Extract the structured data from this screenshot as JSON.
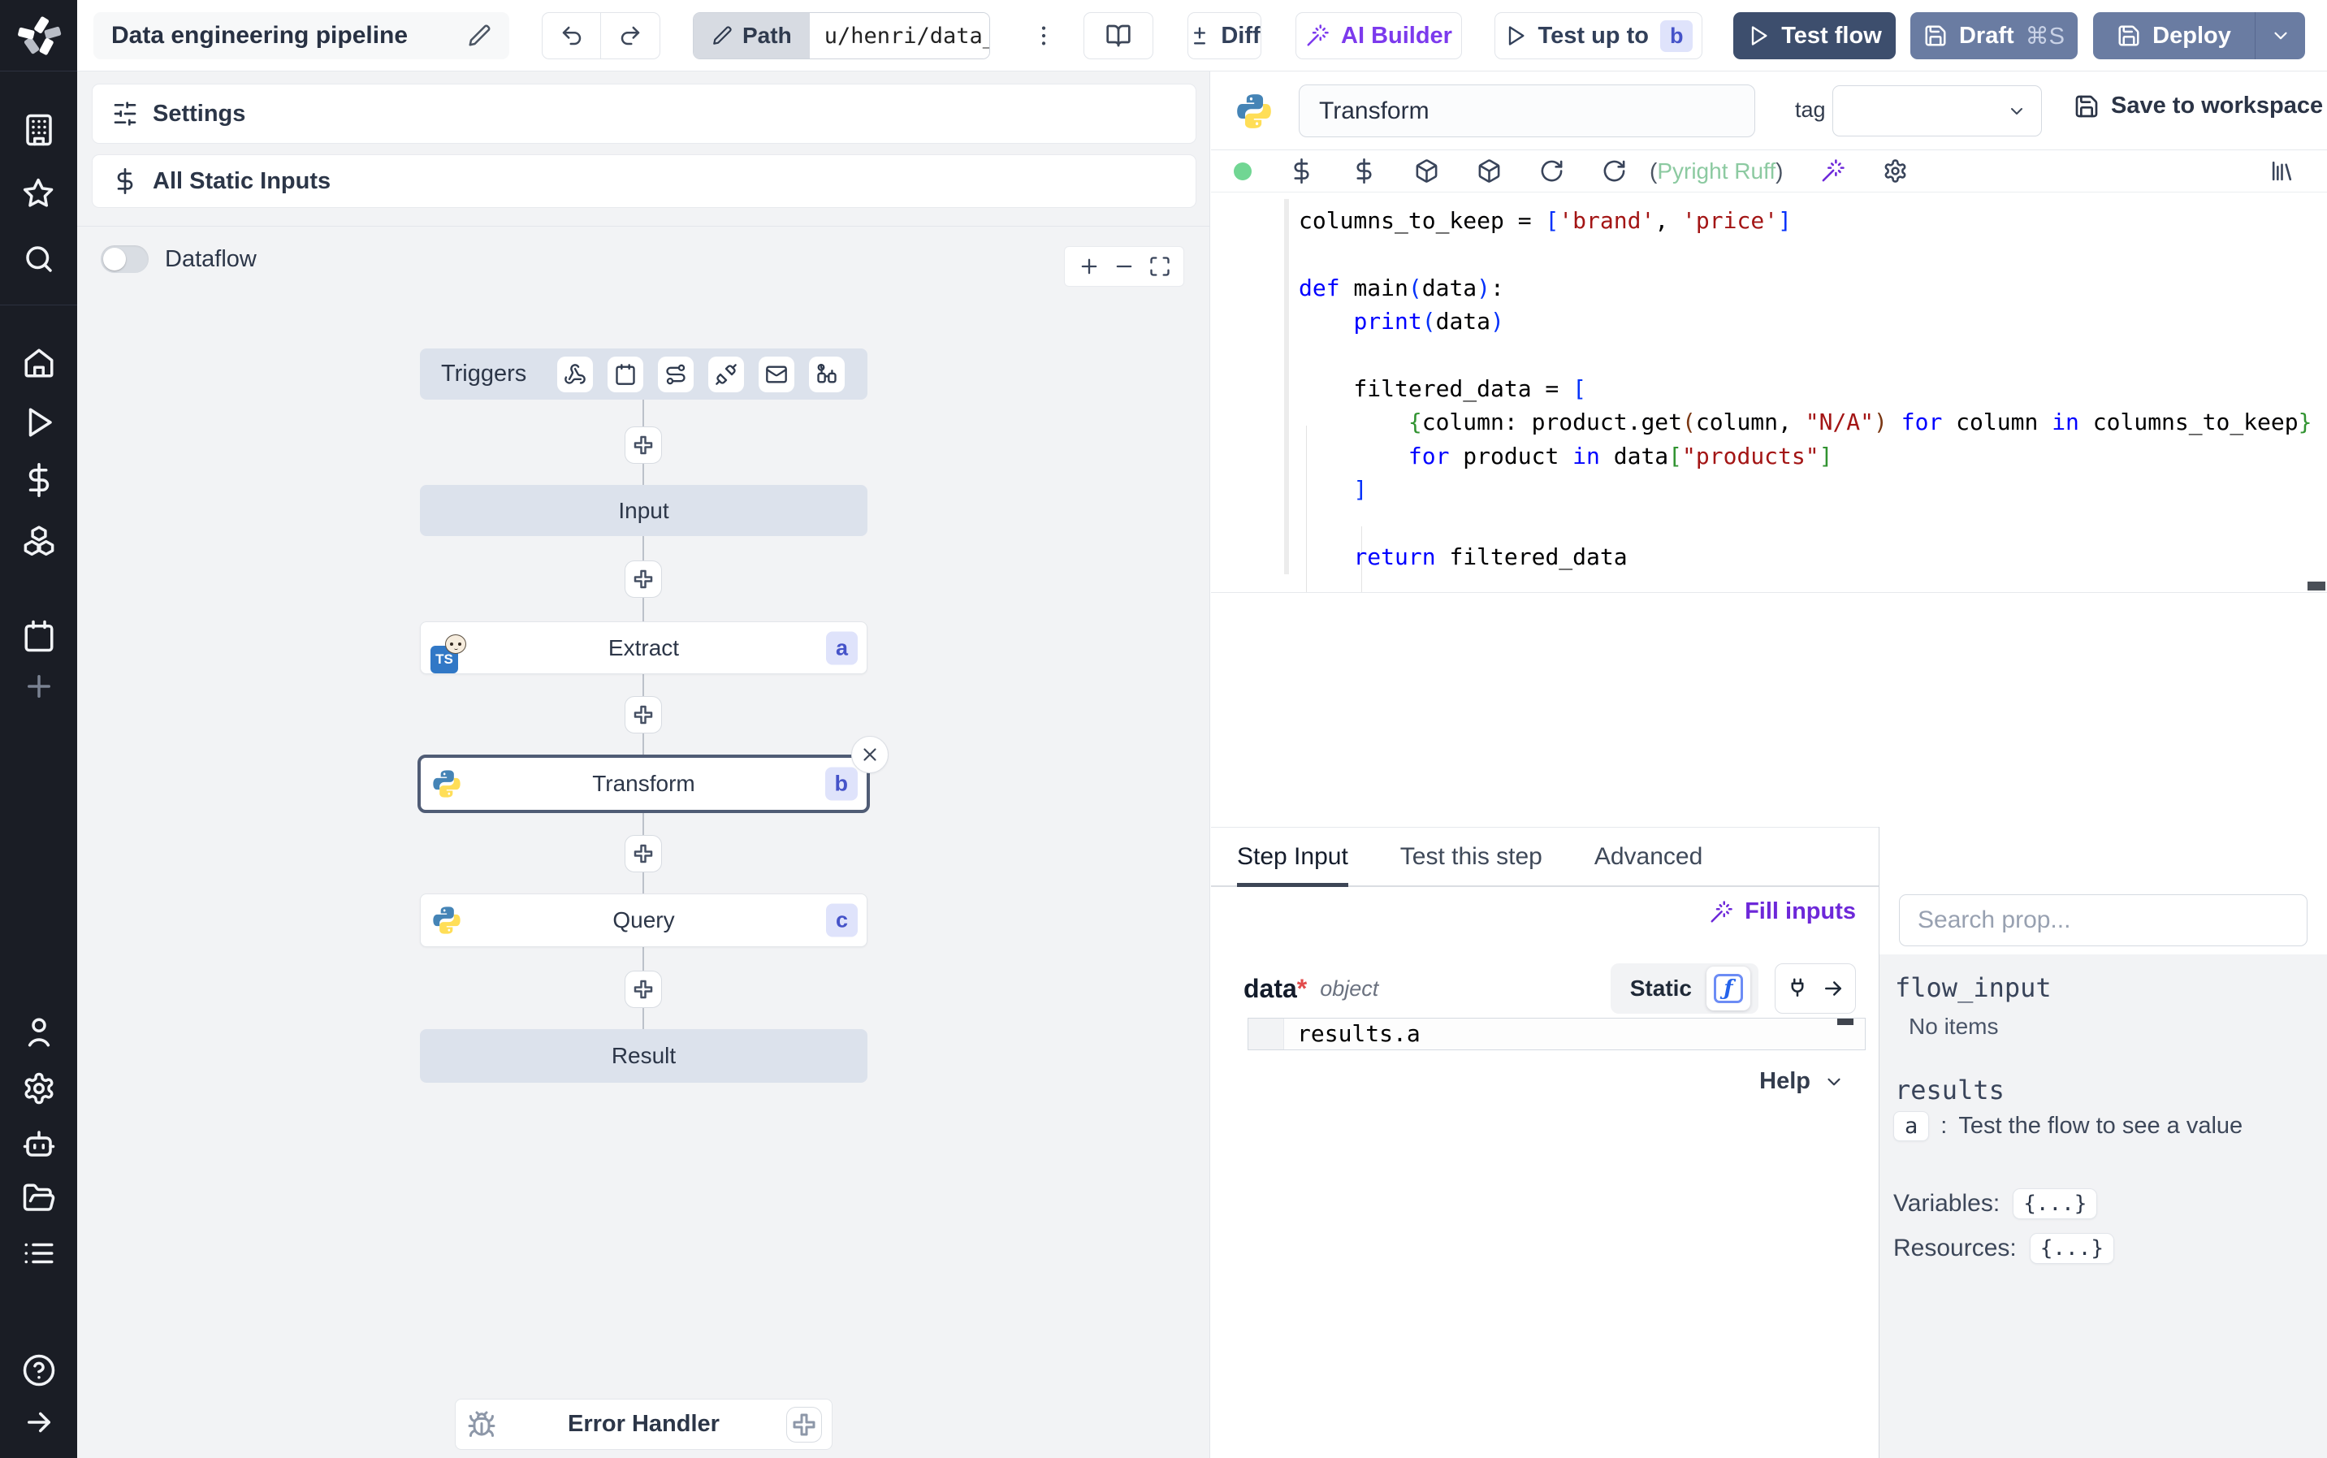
{
  "header": {
    "title": "Data engineering pipeline",
    "path_label": "Path",
    "path_value": "u/henri/data_",
    "diff_label": "Diff",
    "ai_builder_label": "AI Builder",
    "test_up_to_label": "Test up to",
    "test_up_to_badge": "b",
    "test_flow_label": "Test flow",
    "draft_label": "Draft",
    "draft_shortcut": "⌘S",
    "deploy_label": "Deploy"
  },
  "flow": {
    "settings_label": "Settings",
    "all_static_inputs_label": "All Static Inputs",
    "dataflow_label": "Dataflow",
    "triggers_label": "Triggers",
    "trigger_icons": [
      "webhook",
      "schedule-calendar",
      "route",
      "plug",
      "email",
      "poll-watch"
    ],
    "nodes": {
      "input": {
        "label": "Input"
      },
      "extract": {
        "label": "Extract",
        "badge": "a",
        "language": "bun-typescript"
      },
      "transform": {
        "label": "Transform",
        "badge": "b",
        "language": "python",
        "selected": true
      },
      "query": {
        "label": "Query",
        "badge": "c",
        "language": "python"
      },
      "result": {
        "label": "Result"
      },
      "error_handler": {
        "label": "Error Handler"
      }
    }
  },
  "step": {
    "name": "Transform",
    "tag_label": "tag",
    "save_label": "Save to workspace",
    "assistant_open": "(",
    "assistant_name": "Pyright Ruff",
    "assistant_close": ")",
    "code": {
      "language": "python",
      "lines": [
        [
          [
            "d",
            "columns_to_keep = "
          ],
          [
            "b1",
            "["
          ],
          [
            "s",
            "'brand'"
          ],
          [
            "d",
            ", "
          ],
          [
            "s",
            "'price'"
          ],
          [
            "b1",
            "]"
          ]
        ],
        [],
        [
          [
            "k",
            "def"
          ],
          [
            "d",
            " main"
          ],
          [
            "b1",
            "("
          ],
          [
            "d",
            "data"
          ],
          [
            "b1",
            ")"
          ],
          [
            "d",
            ":"
          ]
        ],
        [
          [
            "d",
            "    "
          ],
          [
            "k",
            "print"
          ],
          [
            "b1",
            "("
          ],
          [
            "d",
            "data"
          ],
          [
            "b1",
            ")"
          ]
        ],
        [],
        [
          [
            "d",
            "    filtered_data = "
          ],
          [
            "b1",
            "["
          ]
        ],
        [
          [
            "d",
            "        "
          ],
          [
            "b2",
            "{"
          ],
          [
            "d",
            "column: product.get"
          ],
          [
            "b3",
            "("
          ],
          [
            "d",
            "column, "
          ],
          [
            "s",
            "\"N/A\""
          ],
          [
            "b3",
            ")"
          ],
          [
            "d",
            " "
          ],
          [
            "k",
            "for"
          ],
          [
            "d",
            " column "
          ],
          [
            "k",
            "in"
          ],
          [
            "d",
            " columns_to_keep"
          ],
          [
            "b2",
            "}"
          ]
        ],
        [
          [
            "d",
            "        "
          ],
          [
            "k",
            "for"
          ],
          [
            "d",
            " product "
          ],
          [
            "k",
            "in"
          ],
          [
            "d",
            " data"
          ],
          [
            "b2",
            "["
          ],
          [
            "s",
            "\"products\""
          ],
          [
            "b2",
            "]"
          ]
        ],
        [
          [
            "d",
            "    "
          ],
          [
            "b1",
            "]"
          ]
        ],
        [],
        [
          [
            "d",
            "    "
          ],
          [
            "k",
            "return"
          ],
          [
            "d",
            " filtered_data"
          ]
        ]
      ]
    },
    "tabs": [
      "Step Input",
      "Test this step",
      "Advanced"
    ],
    "fill_inputs_label": "Fill inputs",
    "arg_name": "data",
    "arg_required": "*",
    "arg_type": "object",
    "static_label": "Static",
    "fx_glyph": "ƒ",
    "expr_value": "results.a",
    "help_label": "Help"
  },
  "props": {
    "search_placeholder": "Search prop...",
    "flow_input_label": "flow_input",
    "flow_input_empty": "No items",
    "results_label": "results",
    "result_key": "a",
    "result_sep": ":",
    "result_hint": "Test the flow to see a value",
    "variables_label": "Variables:",
    "variables_value": "{...}",
    "resources_label": "Resources:",
    "resources_value": "{...}"
  },
  "colors": {
    "sidebar_bg": "#1a1d25",
    "canvas_bg": "#f2f3f5",
    "test_flow_bg": "#3d4e6d",
    "draft_deploy_bg": "#6a7ca2",
    "badge_bg": "#dfe3fb",
    "badge_text": "#4553c9",
    "selected_node_border": "#505c75",
    "muted_node_bg": "#dce2ec",
    "ai_purple": "#7c3aed",
    "fill_inputs_purple": "#6d28d9",
    "status_green": "#71d693",
    "assistant_green": "#8ccaa1",
    "code_keyword": "#0000ff",
    "code_string": "#a31515",
    "python_blue": "#4584b6",
    "python_yellow": "#ffde57",
    "typescript_blue": "#3178c6",
    "required_red": "#e24b4b",
    "fx_blue": "#2563eb"
  }
}
